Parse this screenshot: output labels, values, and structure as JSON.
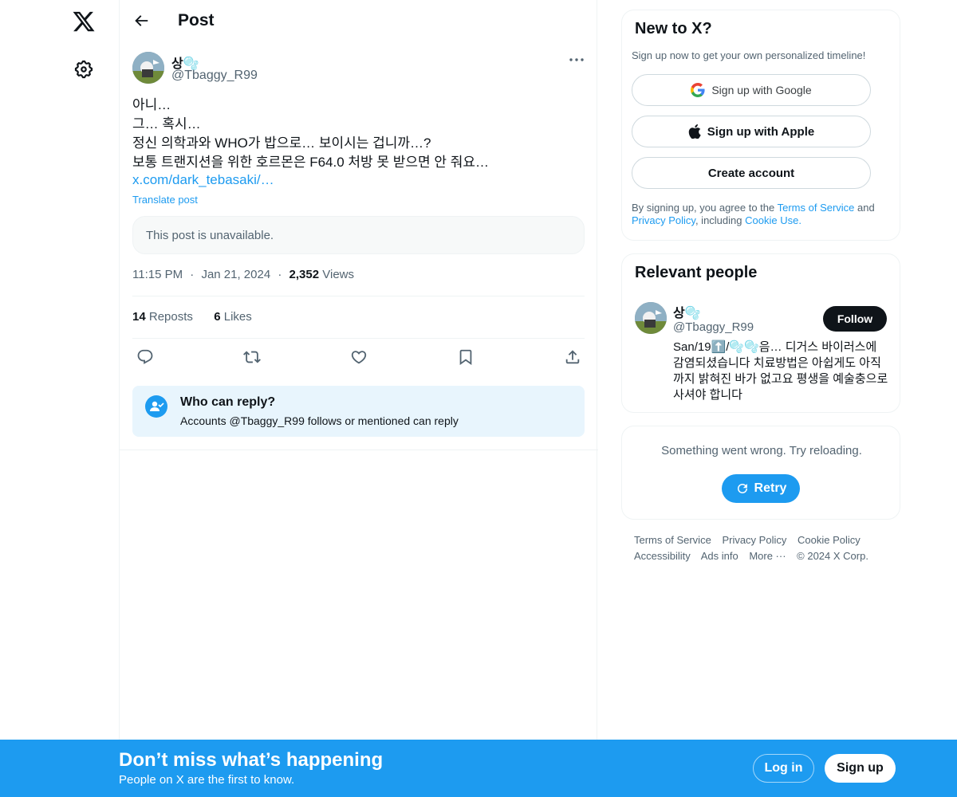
{
  "nav": {
    "logo_icon": "x-logo-icon",
    "settings_icon": "gear-icon"
  },
  "header": {
    "title": "Post",
    "back_icon": "arrow-left-icon"
  },
  "post": {
    "author_name": "상🫧",
    "author_handle": "@Tbaggy_R99",
    "lines": [
      "아니…",
      "그… 혹시…",
      "정신 의학과와 WHO가 밥으로… 보이시는 겁니까…?",
      "보통 트랜지션을 위한 호르몬은 F64.0 처방 못 받으면 안 줘요…"
    ],
    "link": "x.com/dark_tebasaki/…",
    "translate": "Translate post",
    "quoted_unavailable": "This post is unavailable.",
    "time": "11:15 PM",
    "date": "Jan 21, 2024",
    "dot": "·",
    "views_count": "2,352",
    "views_label": "Views",
    "reposts_count": "14",
    "reposts_label": "Reposts",
    "likes_count": "6",
    "likes_label": "Likes"
  },
  "reply_restriction": {
    "title": "Who can reply?",
    "subtitle": "Accounts @Tbaggy_R99 follows or mentioned can reply"
  },
  "signup_card": {
    "title": "New to X?",
    "subtitle": "Sign up now to get your own personalized timeline!",
    "google_label": "Sign up with Google",
    "apple_label": "Sign up with Apple",
    "create_label": "Create account",
    "terms_prefix": "By signing up, you agree to the ",
    "terms_link": "Terms of Service",
    "terms_and": " and ",
    "privacy_link": "Privacy Policy",
    "terms_including": ", including ",
    "cookie_link": "Cookie Use",
    "terms_end": "."
  },
  "relevant_people": {
    "title": "Relevant people",
    "name": "상🫧",
    "handle": "@Tbaggy_R99",
    "follow_label": "Follow",
    "bio": "San/19⬆️/🫧🫧음… 디거스 바이러스에 감염되셨습니다 치료방법은 아쉽게도 아직까지 밝혀진 바가 없고요 평생을 예술충으로 사셔야 합니다"
  },
  "error_card": {
    "message": "Something went wrong. Try reloading.",
    "retry_label": "Retry"
  },
  "footer": {
    "terms": "Terms of Service",
    "privacy": "Privacy Policy",
    "cookie": "Cookie Policy",
    "accessibility": "Accessibility",
    "ads": "Ads info",
    "more": "More ···",
    "copyright": "© 2024 X Corp."
  },
  "banner": {
    "title": "Don’t miss what’s happening",
    "subtitle": "People on X are the first to know.",
    "login_label": "Log in",
    "signup_label": "Sign up"
  },
  "colors": {
    "accent": "#1d9bf0",
    "text": "#0f1419",
    "muted": "#536471"
  }
}
